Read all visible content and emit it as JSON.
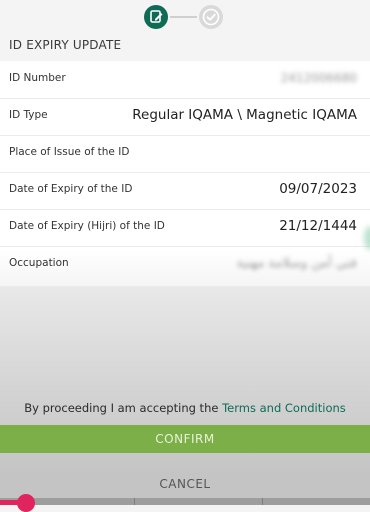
{
  "stepper": {
    "steps": [
      {
        "state": "active",
        "icon": "edit-document-icon"
      },
      {
        "state": "inactive",
        "icon": "check-circle-icon"
      }
    ]
  },
  "section": {
    "title": "ID EXPIRY UPDATE"
  },
  "fields": [
    {
      "label": "ID Number",
      "value": "2412006680",
      "blurred": true
    },
    {
      "label": "ID Type",
      "value": "Regular IQAMA \\ Magnetic IQAMA",
      "blurred": false
    },
    {
      "label": "Place of Issue of the ID",
      "value": "",
      "blurred": false
    },
    {
      "label": "Date of Expiry of the ID",
      "value": "09/07/2023",
      "blurred": false
    },
    {
      "label": "Date of Expiry (Hijri) of the ID",
      "value": "21/12/1444",
      "blurred": false
    },
    {
      "label": "Occupation",
      "value": "فني أمن وسلامة مهنية",
      "blurred": true
    }
  ],
  "terms": {
    "prefix": "By proceeding I am accepting the ",
    "link": "Terms and Conditions"
  },
  "actions": {
    "confirm_label": "CONFIRM",
    "cancel_label": "CANCEL"
  },
  "colors": {
    "brand_green": "#0f6b56",
    "confirm_green": "#7caf47",
    "cancel_gray": "#c4c4c4"
  }
}
